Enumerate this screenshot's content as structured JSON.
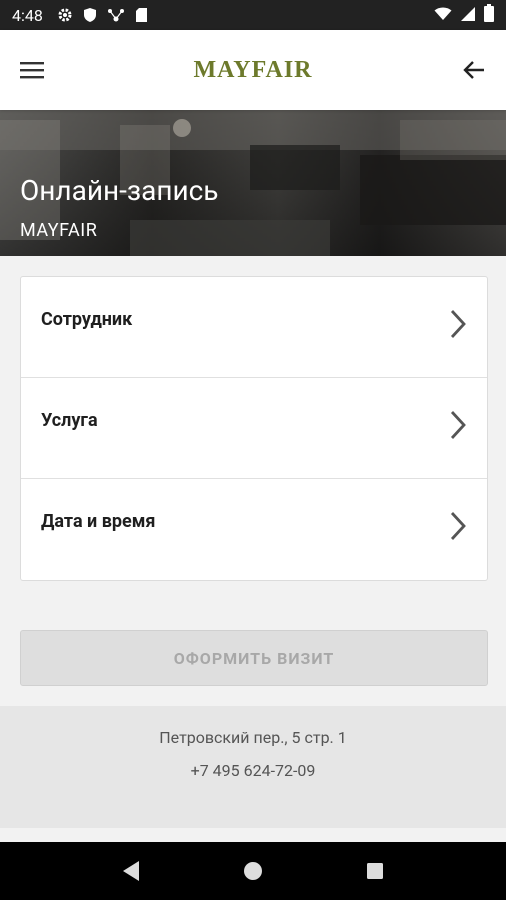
{
  "status_bar": {
    "time": "4:48",
    "left_icons": [
      "gear-icon",
      "shield-icon",
      "network-icon",
      "sd-card-icon"
    ],
    "right_icons": [
      "wifi-icon",
      "signal-icon",
      "battery-icon"
    ]
  },
  "app_bar": {
    "logo": "MAYFAIR",
    "menu_icon": "hamburger-menu-icon",
    "back_icon": "arrow-back-icon"
  },
  "hero": {
    "title": "Онлайн-запись",
    "subtitle": "MAYFAIR"
  },
  "booking_options": [
    {
      "label": "Сотрудник"
    },
    {
      "label": "Услуга"
    },
    {
      "label": "Дата и время"
    }
  ],
  "submit_button": {
    "label": "ОФОРМИТЬ ВИЗИТ",
    "state": "disabled"
  },
  "footer": {
    "address": "Петровский пер., 5 стр. 1",
    "phone": "+7 495 624-72-09"
  },
  "colors": {
    "logo": "#6d7a2c",
    "status_bar": "#222222",
    "button_disabled_bg": "#dedede",
    "button_disabled_text": "#a8a8a8"
  }
}
